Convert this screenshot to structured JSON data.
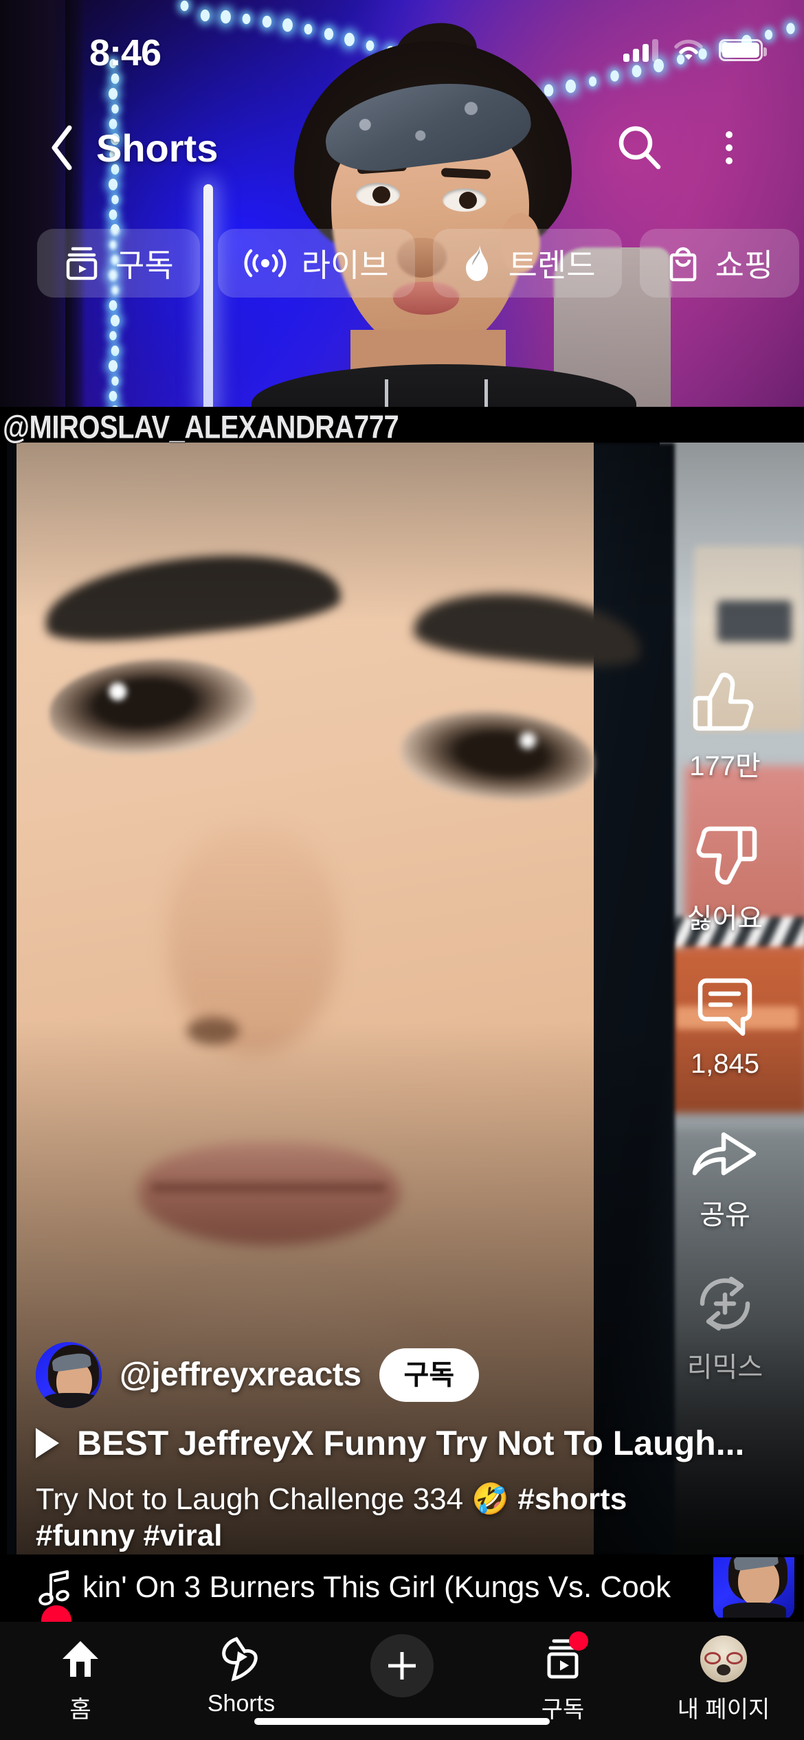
{
  "status_bar": {
    "time": "8:46",
    "signal_icon": "cellular-bars-icon",
    "wifi_icon": "wifi-icon",
    "battery_icon": "battery-full-icon"
  },
  "header": {
    "back_icon": "chevron-left-icon",
    "title": "Shorts",
    "search_icon": "search-icon",
    "more_icon": "more-vertical-icon"
  },
  "chips": [
    {
      "label": "구독",
      "icon": "subscriptions-icon"
    },
    {
      "label": "라이브",
      "icon": "live-broadcast-icon"
    },
    {
      "label": "트렌드",
      "icon": "flame-trending-icon"
    },
    {
      "label": "쇼핑",
      "icon": "shopping-bag-icon"
    }
  ],
  "video": {
    "watermark": "@MIROSLAV_ALEXANDRA777",
    "progress_percent": 7
  },
  "actions": [
    {
      "name": "like",
      "icon": "thumb-up-icon",
      "label": "177만",
      "dimmed": false
    },
    {
      "name": "dislike",
      "icon": "thumb-down-icon",
      "label": "싫어요",
      "dimmed": false
    },
    {
      "name": "comments",
      "icon": "comment-bubble-icon",
      "label": "1,845",
      "dimmed": false
    },
    {
      "name": "share",
      "icon": "share-arrow-icon",
      "label": "공유",
      "dimmed": false
    },
    {
      "name": "remix",
      "icon": "remix-icon",
      "label": "리믹스",
      "dimmed": true
    }
  ],
  "meta": {
    "avatar_icon": "channel-avatar",
    "channel_handle": "@jeffreyxreacts",
    "subscribe_label": "구독",
    "play_icon": "play-triangle-icon",
    "title": "BEST JeffreyX Funny Try Not To Laugh...",
    "description_line1_plain": "Try Not to Laugh Challenge 334 🤣 ",
    "description_line1_tag": "#shorts",
    "description_line2": "#funny #viral"
  },
  "music": {
    "note_icon": "music-note-icon",
    "ticker_text": "kin' On 3 Burners    This Girl (Kungs Vs. Cook",
    "thumbnail_icon": "music-thumbnail"
  },
  "bottom_nav": [
    {
      "label": "홈",
      "icon": "home-icon",
      "badge": false
    },
    {
      "label": "Shorts",
      "icon": "shorts-bolt-icon",
      "badge": false
    },
    {
      "label": "",
      "icon": "plus-create-icon",
      "badge": false
    },
    {
      "label": "구독",
      "icon": "subscriptions-box-icon",
      "badge": true
    },
    {
      "label": "내 페이지",
      "icon": "profile-avatar-icon",
      "badge": false
    }
  ],
  "colors": {
    "accent_red": "#ff0033",
    "white": "#ffffff",
    "nav_bg": "#0d0d0d"
  }
}
